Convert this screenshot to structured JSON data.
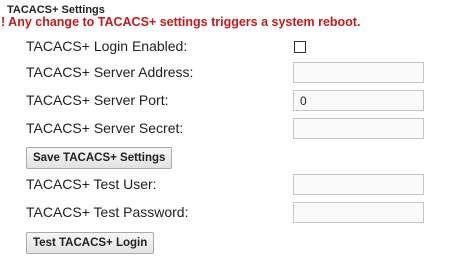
{
  "section": {
    "title": "TACACS+ Settings",
    "warning": "! Any change to TACACS+ settings triggers a system reboot."
  },
  "login_enabled": {
    "label": "TACACS+ Login Enabled:",
    "checked": false
  },
  "server_address": {
    "label": "TACACS+ Server Address:",
    "value": ""
  },
  "server_port": {
    "label": "TACACS+ Server Port:",
    "value": "0"
  },
  "server_secret": {
    "label": "TACACS+ Server Secret:",
    "value": ""
  },
  "save_button": {
    "label": "Save TACACS+ Settings"
  },
  "test_user": {
    "label": "TACACS+ Test User:",
    "value": ""
  },
  "test_password": {
    "label": "TACACS+ Test Password:",
    "value": ""
  },
  "test_button": {
    "label": "Test TACACS+ Login"
  }
}
